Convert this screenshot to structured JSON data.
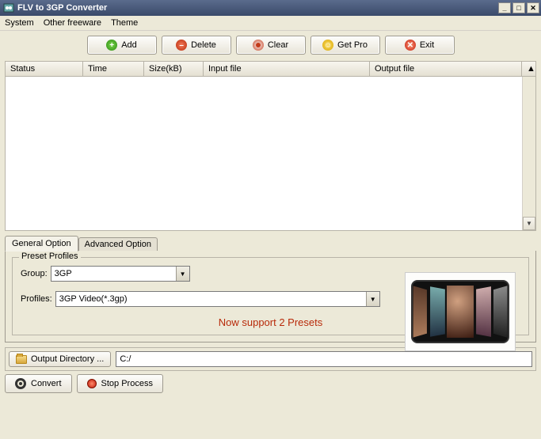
{
  "window": {
    "title": "FLV to 3GP Converter"
  },
  "menu": {
    "system": "System",
    "freeware": "Other freeware",
    "theme": "Theme"
  },
  "toolbar": {
    "add": "Add",
    "delete": "Delete",
    "clear": "Clear",
    "getpro": "Get Pro",
    "exit": "Exit"
  },
  "columns": {
    "status": "Status",
    "time": "Time",
    "size": "Size(kB)",
    "input": "Input file",
    "output": "Output file"
  },
  "tabs": {
    "general": "General Option",
    "advanced": "Advanced Option"
  },
  "preset": {
    "legend": "Preset Profiles",
    "group_label": "Group:",
    "group_value": "3GP",
    "profiles_label": "Profiles:",
    "profiles_value": "3GP Video(*.3gp)",
    "support_text": "Now support 2 Presets"
  },
  "output": {
    "button": "Output Directory ...",
    "path": "C:/"
  },
  "actions": {
    "convert": "Convert",
    "stop": "Stop Process"
  }
}
